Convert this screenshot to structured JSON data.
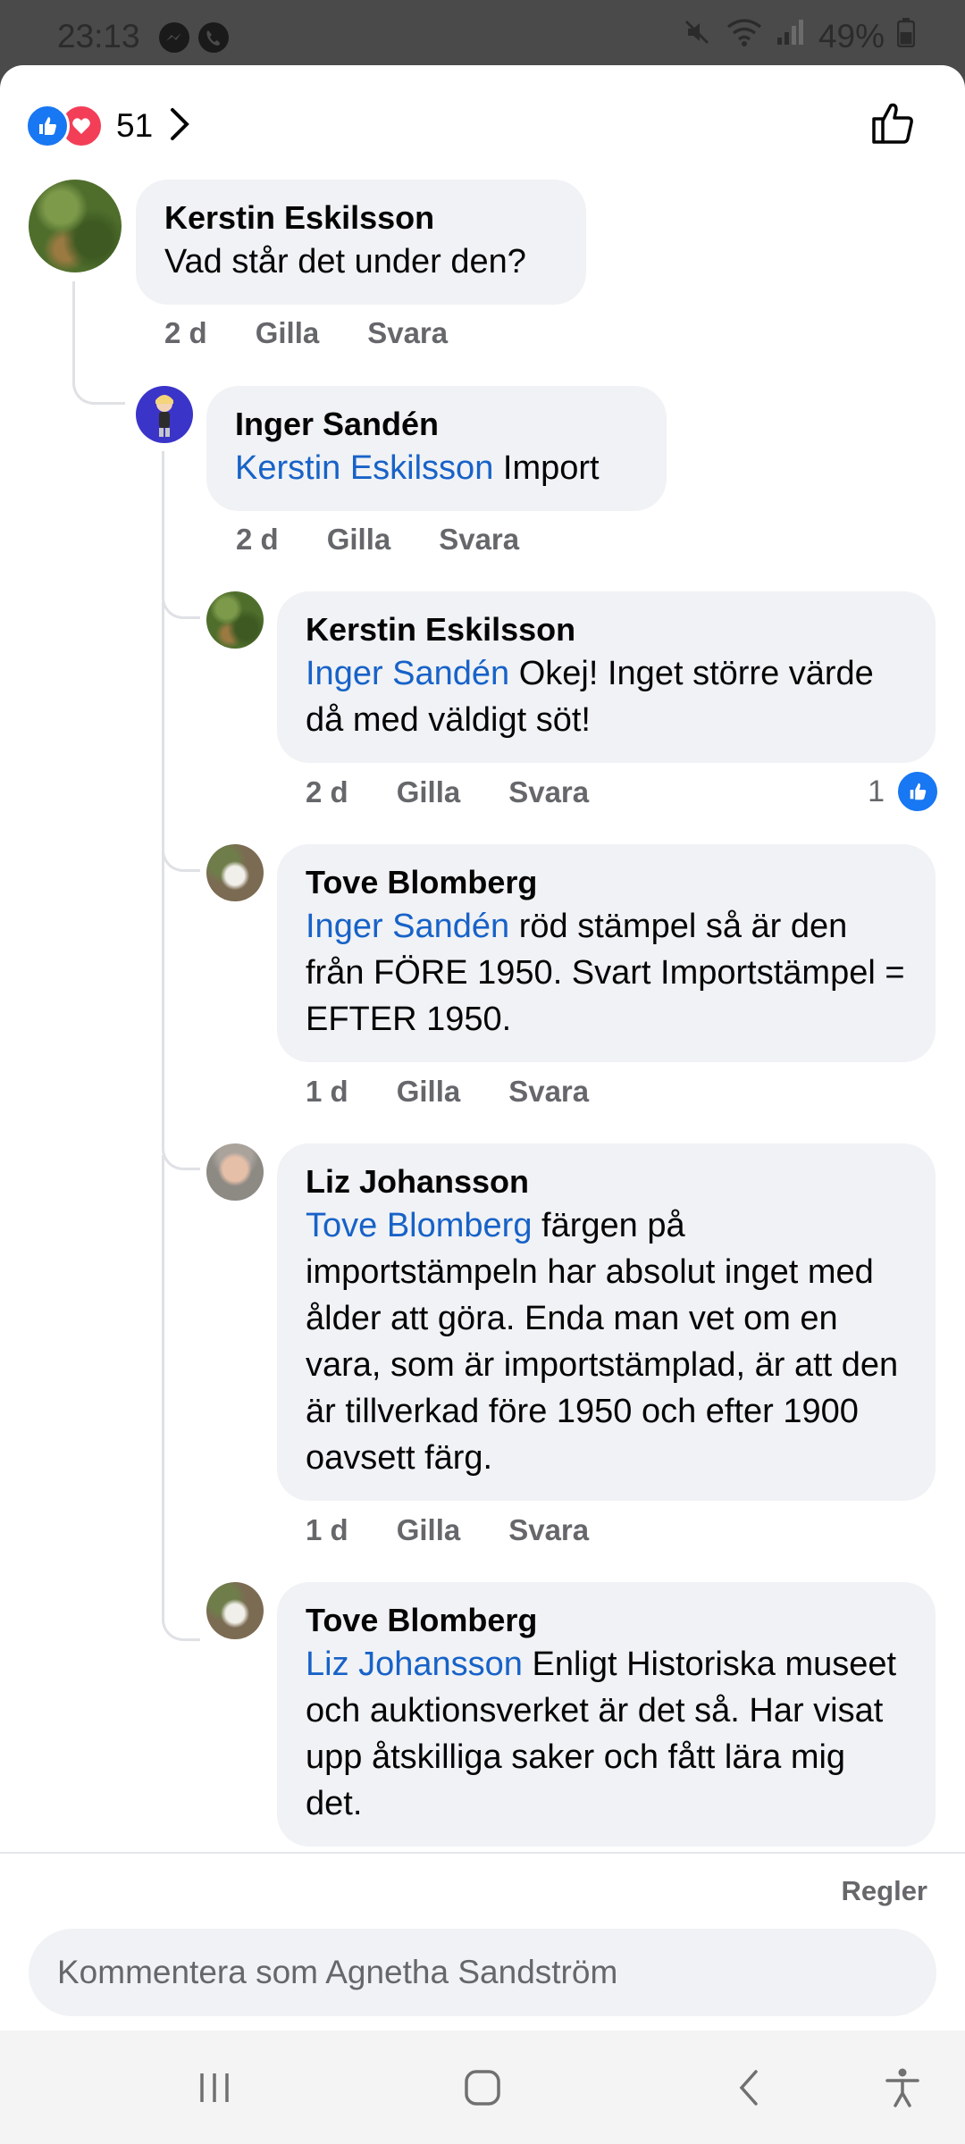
{
  "status_bar": {
    "time": "23:13",
    "notification_icons": [
      "messenger-icon",
      "phone-icon"
    ],
    "battery": "49%",
    "status_icons": [
      "mute-icon",
      "wifi-icon",
      "signal-icon",
      "battery-icon"
    ]
  },
  "reactions": {
    "icons": [
      "like-reaction-icon",
      "love-reaction-icon"
    ],
    "count": "51"
  },
  "comments": [
    {
      "author": "Kerstin Eskilsson",
      "mention": "",
      "text": "Vad står det under den?",
      "time": "2 d",
      "like": "Gilla",
      "reply": "Svara"
    },
    {
      "author": "Inger Sandén",
      "mention": "Kerstin Eskilsson",
      "text": " Import",
      "time": "2 d",
      "like": "Gilla",
      "reply": "Svara"
    },
    {
      "author": "Kerstin Eskilsson",
      "mention": "Inger Sandén",
      "text": " Okej! Inget större värde då med väldigt söt!",
      "time": "2 d",
      "like": "Gilla",
      "reply": "Svara",
      "reaction_count": "1"
    },
    {
      "author": "Tove Blomberg",
      "mention": "Inger Sandén",
      "text": " röd stämpel så är den från FÖRE 1950. Svart Importstämpel = EFTER 1950.",
      "time": "1 d",
      "like": "Gilla",
      "reply": "Svara"
    },
    {
      "author": "Liz Johansson",
      "mention": "Tove Blomberg",
      "text": " färgen på importstämpeln har absolut inget med ålder att göra. Enda man vet om en vara, som är importstämplad, är att den är tillverkad före 1950 och efter 1900 oavsett färg.",
      "time": "1 d",
      "like": "Gilla",
      "reply": "Svara"
    },
    {
      "author": "Tove Blomberg",
      "mention": "Liz Johansson",
      "text": " Enligt Historiska museet och auktionsverket är det så. Har visat upp åtskilliga saker och fått lära mig det."
    }
  ],
  "footer": {
    "rules_link": "Regler",
    "composer_placeholder": "Kommentera som Agnetha Sandström"
  },
  "colors": {
    "mention": "#1762c8",
    "like_blue": "#1877f2",
    "love_red": "#f33e58",
    "bubble": "#f0f2f5",
    "meta_gray": "#65676b"
  }
}
